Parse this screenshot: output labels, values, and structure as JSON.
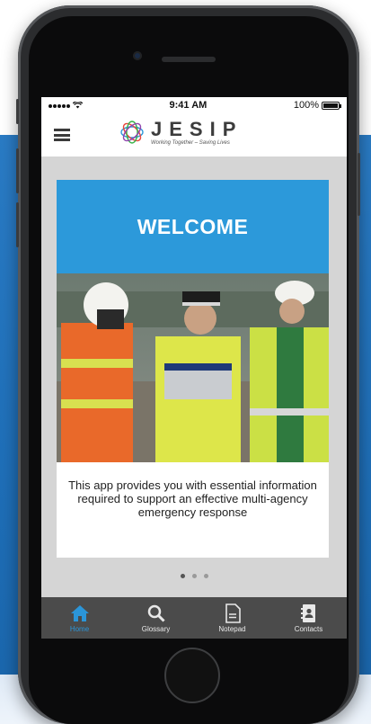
{
  "status_bar": {
    "time": "9:41 AM",
    "battery": "100%"
  },
  "header": {
    "logo_word": "JESIP",
    "tagline": "Working Together – Saving Lives"
  },
  "card": {
    "title": "WELCOME",
    "body": "This app provides you with essential information required to support an effective multi-agency emergency response"
  },
  "pager": {
    "current": 1,
    "total": 3
  },
  "tabs": [
    {
      "label": "Home",
      "icon": "home-icon",
      "active": true
    },
    {
      "label": "Glossary",
      "icon": "search-icon",
      "active": false
    },
    {
      "label": "Notepad",
      "icon": "note-icon",
      "active": false
    },
    {
      "label": "Contacts",
      "icon": "contacts-icon",
      "active": false
    }
  ],
  "colors": {
    "accent": "#2c99da",
    "tabbar": "#4b4b4b",
    "background_blue": "#1f6fb8"
  }
}
